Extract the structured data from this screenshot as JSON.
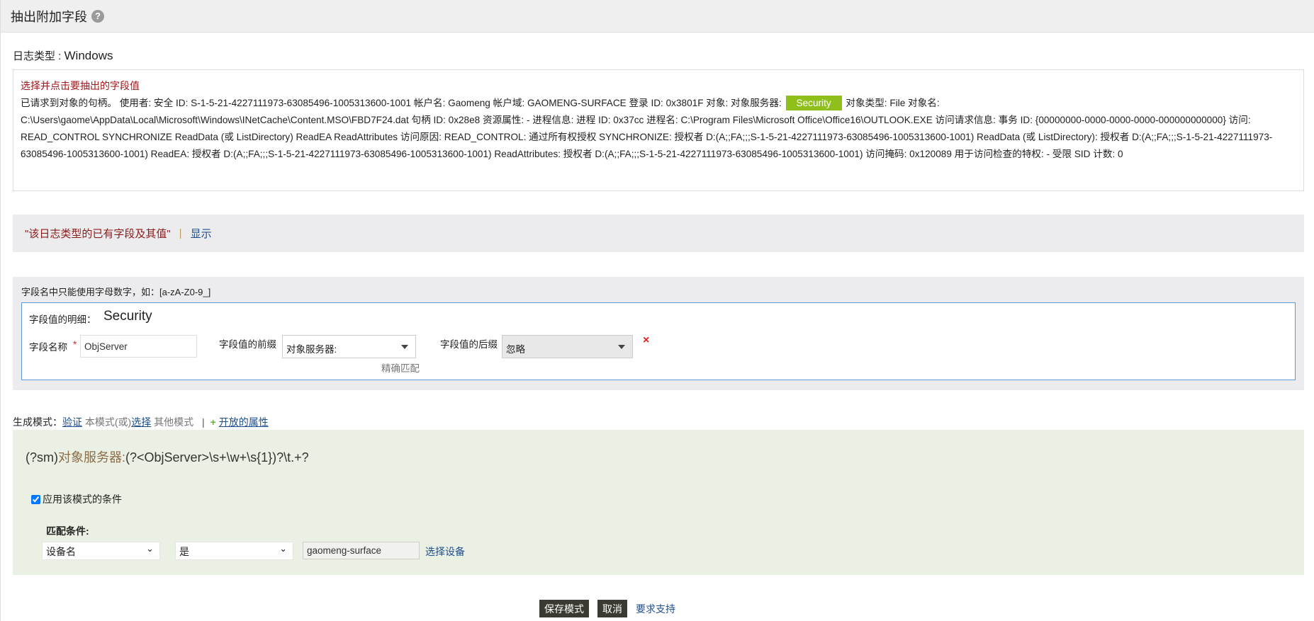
{
  "title": "抽出附加字段",
  "help_icon": "?",
  "log_type": {
    "label": "日志类型 : ",
    "value": "Windows"
  },
  "log": {
    "hint": "选择并点击要抽出的字段值",
    "before": "已请求到对象的句柄。 使用者: 安全 ID: S-1-5-21-4227111973-63085496-1005313600-1001 帐户名: Gaomeng 帐户域: GAOMENG-SURFACE 登录 ID: 0x3801F 对象: 对象服务器: ",
    "selected": "Security",
    "after": " 对象类型: File 对象名: C:\\Users\\gaome\\AppData\\Local\\Microsoft\\Windows\\INetCache\\Content.MSO\\FBD7F24.dat 句柄 ID: 0x28e8 资源属性: - 进程信息: 进程 ID: 0x37cc 进程名: C:\\Program Files\\Microsoft Office\\Office16\\OUTLOOK.EXE 访问请求信息: 事务 ID: {00000000-0000-0000-0000-000000000000} 访问: READ_CONTROL SYNCHRONIZE ReadData (或 ListDirectory) ReadEA ReadAttributes 访问原因: READ_CONTROL: 通过所有权授权 SYNCHRONIZE: 授权者 D:(A;;FA;;;S-1-5-21-4227111973-63085496-1005313600-1001) ReadData (或 ListDirectory): 授权者 D:(A;;FA;;;S-1-5-21-4227111973-63085496-1005313600-1001) ReadEA: 授权者 D:(A;;FA;;;S-1-5-21-4227111973-63085496-1005313600-1001) ReadAttributes: 授权者 D:(A;;FA;;;S-1-5-21-4227111973-63085496-1005313600-1001) 访问掩码: 0x120089 用于访问检查的特权: - 受限 SID 计数: 0"
  },
  "existing": {
    "label": "\"该日志类型的已有字段及其值\"",
    "sep": "|",
    "link": "显示"
  },
  "form": {
    "rule": "字段名中只能使用字母数字，如：[a-zA-Z0-9_]",
    "detail_label": "字段值的明细：",
    "detail_value": "Security",
    "name_label": "字段名称",
    "required": "*",
    "name_value": "ObjServer",
    "prefix_label": "字段值的前缀",
    "prefix_value": "对象服务器:",
    "exact_match": "精确匹配",
    "suffix_label": "字段值的后缀",
    "suffix_value": "忽略",
    "remove": "×"
  },
  "generate": {
    "label": "生成模式：",
    "verify": "验证",
    "mid": " 本模式(或)",
    "select": "选择",
    "other": " 其他模式",
    "sep": "|",
    "plus": "+",
    "open_attrs": "开放的属性"
  },
  "regex": {
    "p1": "(?sm)",
    "p2": "对象服务器:",
    "p3": "(?<ObjServer>\\s+\\w+\\s{1})?\\t.+?"
  },
  "condition": {
    "checkbox_label": "应用该模式的条件",
    "checked": true,
    "match_label": "匹配条件:",
    "field": "设备名",
    "operator": "是",
    "value": "gaomeng-surface",
    "select_device": "选择设备"
  },
  "buttons": {
    "save": "保存模式",
    "cancel": "取消",
    "support": "要求支持"
  }
}
